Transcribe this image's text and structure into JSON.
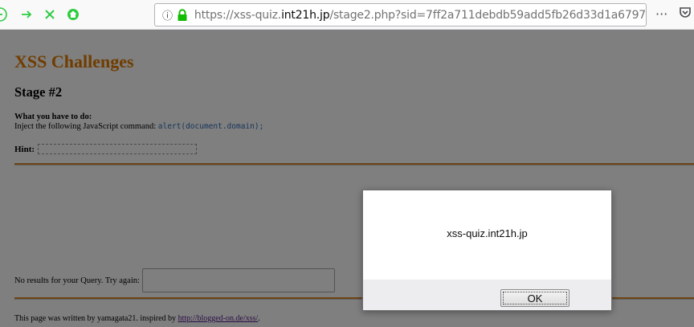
{
  "browser": {
    "url_prefix": "https://xss-quiz.",
    "url_host": "int21h.jp",
    "url_rest": "/stage2.php?sid=7ff2a711debdb59add5fb26d33d1a6797",
    "info_glyph": "ⓘ",
    "more_glyph": "···",
    "pocket_glyph": "◫",
    "bookmark_glyph": "☆",
    "icons": [
      "back-icon",
      "forward-icon",
      "stop-icon",
      "home-icon",
      "info-icon",
      "lock-icon",
      "page-actions-icon",
      "pocket-icon",
      "bookmark-star-icon"
    ],
    "accent_color": "#2ecc40"
  },
  "page": {
    "title": "XSS Challenges",
    "stage": "Stage #2",
    "task_heading": "What you have to do:",
    "task_text": "Inject the following JavaScript command: ",
    "task_code": "alert(document.domain);",
    "hint_label": "Hint:",
    "query_label": "No results for your Query. Try again:",
    "query_value": "",
    "footer_text": "This page was written by yamagata21. inspired by ",
    "footer_link": "http://blogged-on.de/xss/",
    "footer_end": ".",
    "title_color": "#e07a00",
    "rule_color": "#d9892a"
  },
  "dialog": {
    "message": "xss-quiz.int21h.jp",
    "ok_label": "OK"
  }
}
